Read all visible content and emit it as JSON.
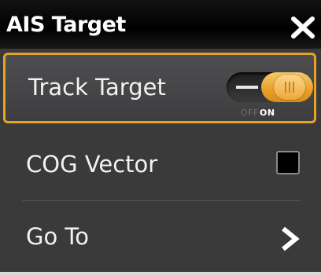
{
  "header": {
    "title": "AIS Target",
    "close_icon": "close-icon"
  },
  "menu": {
    "items": [
      {
        "label": "Track Target",
        "control": "toggle",
        "state": "on",
        "off_label": "OFF",
        "on_label": "ON",
        "selected": true
      },
      {
        "label": "COG Vector",
        "control": "checkbox",
        "checked": false
      },
      {
        "label": "Go To",
        "control": "chevron-right-icon"
      }
    ]
  },
  "colors": {
    "accent": "#e7a22a",
    "background": "#3d3d3e",
    "header": "#000000",
    "text": "#f2f2f2"
  }
}
